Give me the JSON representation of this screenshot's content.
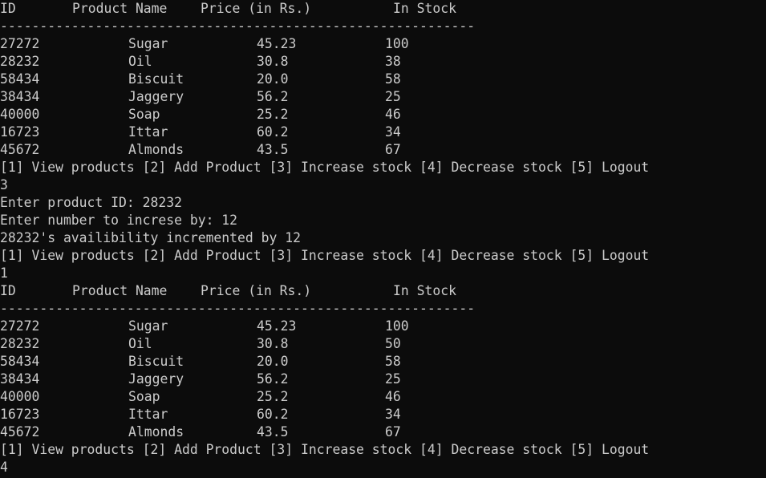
{
  "terminal": {
    "table_headers": [
      "ID",
      "Product Name",
      "Price (in Rs.)",
      "In Stock"
    ],
    "divider": "------------------------------------------------------------",
    "menu_line": "[1] View products [2] Add Product [3] Increase stock [4] Decrease stock [5] Logout",
    "table1_rows": [
      {
        "id": "27272",
        "name": "Sugar",
        "price": "45.23",
        "stock": "100"
      },
      {
        "id": "28232",
        "name": "Oil",
        "price": "30.8",
        "stock": "38"
      },
      {
        "id": "58434",
        "name": "Biscuit",
        "price": "20.0",
        "stock": "58"
      },
      {
        "id": "38434",
        "name": "Jaggery",
        "price": "56.2",
        "stock": "25"
      },
      {
        "id": "40000",
        "name": "Soap",
        "price": "25.2",
        "stock": "46"
      },
      {
        "id": "16723",
        "name": "Ittar",
        "price": "60.2",
        "stock": "34"
      },
      {
        "id": "45672",
        "name": "Almonds",
        "price": "43.5",
        "stock": "67"
      }
    ],
    "input_choice_1": "3",
    "prompt_product_id": "Enter product ID: 28232",
    "prompt_increase_by": "Enter number to increse by: 12",
    "message_incremented": "28232's availibility incremented by 12",
    "input_choice_2": "1",
    "table2_rows": [
      {
        "id": "27272",
        "name": "Sugar",
        "price": "45.23",
        "stock": "100"
      },
      {
        "id": "28232",
        "name": "Oil",
        "price": "30.8",
        "stock": "50"
      },
      {
        "id": "58434",
        "name": "Biscuit",
        "price": "20.0",
        "stock": "58"
      },
      {
        "id": "38434",
        "name": "Jaggery",
        "price": "56.2",
        "stock": "25"
      },
      {
        "id": "40000",
        "name": "Soap",
        "price": "25.2",
        "stock": "46"
      },
      {
        "id": "16723",
        "name": "Ittar",
        "price": "60.2",
        "stock": "34"
      },
      {
        "id": "45672",
        "name": "Almonds",
        "price": "43.5",
        "stock": "67"
      }
    ],
    "input_choice_3": "4"
  },
  "colors": {
    "background": "#0c0c0c",
    "text": "#cccccc"
  }
}
